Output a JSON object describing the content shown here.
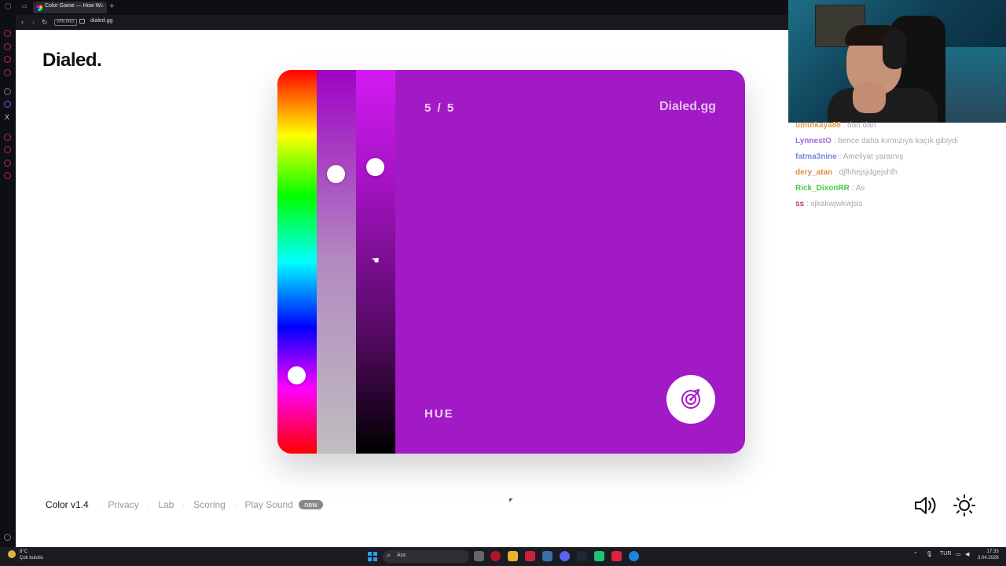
{
  "browser": {
    "tab_title": "Color Game — How W",
    "tab_close": "×",
    "new_tab": "+",
    "vpn_badge": "VPN PRO",
    "url": "dialed.gg",
    "back": "‹",
    "forward": "›",
    "reload": "↻"
  },
  "sidebar": {
    "x_label": "X"
  },
  "page": {
    "logo": "Dialed.",
    "game": {
      "round": "5 / 5",
      "brand": "Dialed.gg",
      "mode": "HUE",
      "color": "#a21ac6",
      "hue_value": 0.81,
      "saturation_value": 0.26,
      "lightness_value": 0.24
    },
    "footer": {
      "version": "Color v1.4",
      "links": [
        "Privacy",
        "Lab",
        "Scoring",
        "Play Sound"
      ],
      "badge": "new",
      "sep": "·"
    },
    "tiny_mark": "◤"
  },
  "stream": {
    "chat": [
      {
        "user": "umutkaya88",
        "user_color": "#e2a04a",
        "message": "dan dan"
      },
      {
        "user": "LynnestO",
        "user_color": "#9b6bd6",
        "message": "bence daha kırmızıya kaçık gibiydi"
      },
      {
        "user": "fatma3nine",
        "user_color": "#6f8fd9",
        "message": "Ameliyat yaramış"
      },
      {
        "user": "dery_atan",
        "user_color": "#d98f3c",
        "message": "djfhhejsjdgejshfh"
      },
      {
        "user": "Rick_DixonRR",
        "user_color": "#44c744",
        "message": "As"
      },
      {
        "user": "ss",
        "user_color": "#d23b55",
        "message": "sjkakwjwkwjsis"
      }
    ],
    "chat_sep": " : "
  },
  "taskbar": {
    "weather_temp": "8°C",
    "weather_desc": "Çok bulutlu",
    "search_placeholder": "Ara",
    "language": "TUR",
    "time": "17:33",
    "date": "3.04.2026"
  }
}
